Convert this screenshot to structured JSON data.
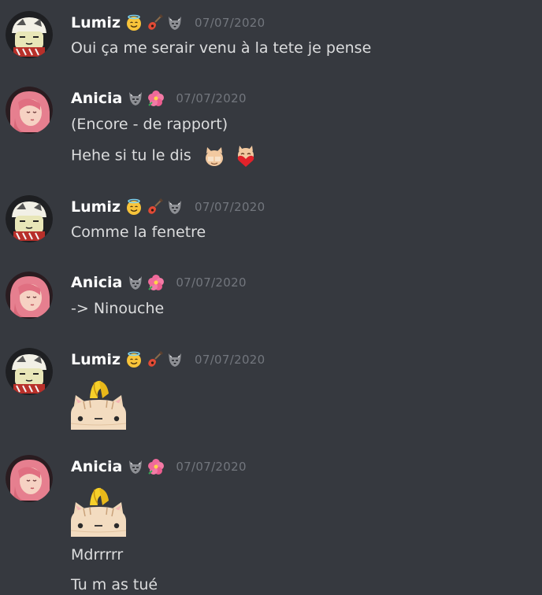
{
  "messages": [
    {
      "author": "Lumiz",
      "timestamp": "07/07/2020",
      "lines": [
        "Oui ça me serair venu à la tete je pense"
      ]
    },
    {
      "author": "Anicia",
      "timestamp": "07/07/2020",
      "lines": [
        "(Encore - de rapport)",
        "Hehe si tu le dis"
      ]
    },
    {
      "author": "Lumiz",
      "timestamp": "07/07/2020",
      "lines": [
        "Comme la fenetre"
      ]
    },
    {
      "author": "Anicia",
      "timestamp": "07/07/2020",
      "lines": [
        "-> Ninouche"
      ]
    },
    {
      "author": "Lumiz",
      "timestamp": "07/07/2020",
      "lines": []
    },
    {
      "author": "Anicia",
      "timestamp": "07/07/2020",
      "lines": [
        "Mdrrrrr",
        "Tu m as tué"
      ]
    }
  ],
  "badges": {
    "lumiz": [
      "halo-smile-emoji",
      "guitar-emoji",
      "wolf-emoji"
    ],
    "anicia": [
      "wolf-emoji",
      "hibiscus-flower-emoji"
    ]
  },
  "colors": {
    "background": "#36393f",
    "author": "#ffffff",
    "text": "#dcddde",
    "timestamp": "#72767d"
  }
}
